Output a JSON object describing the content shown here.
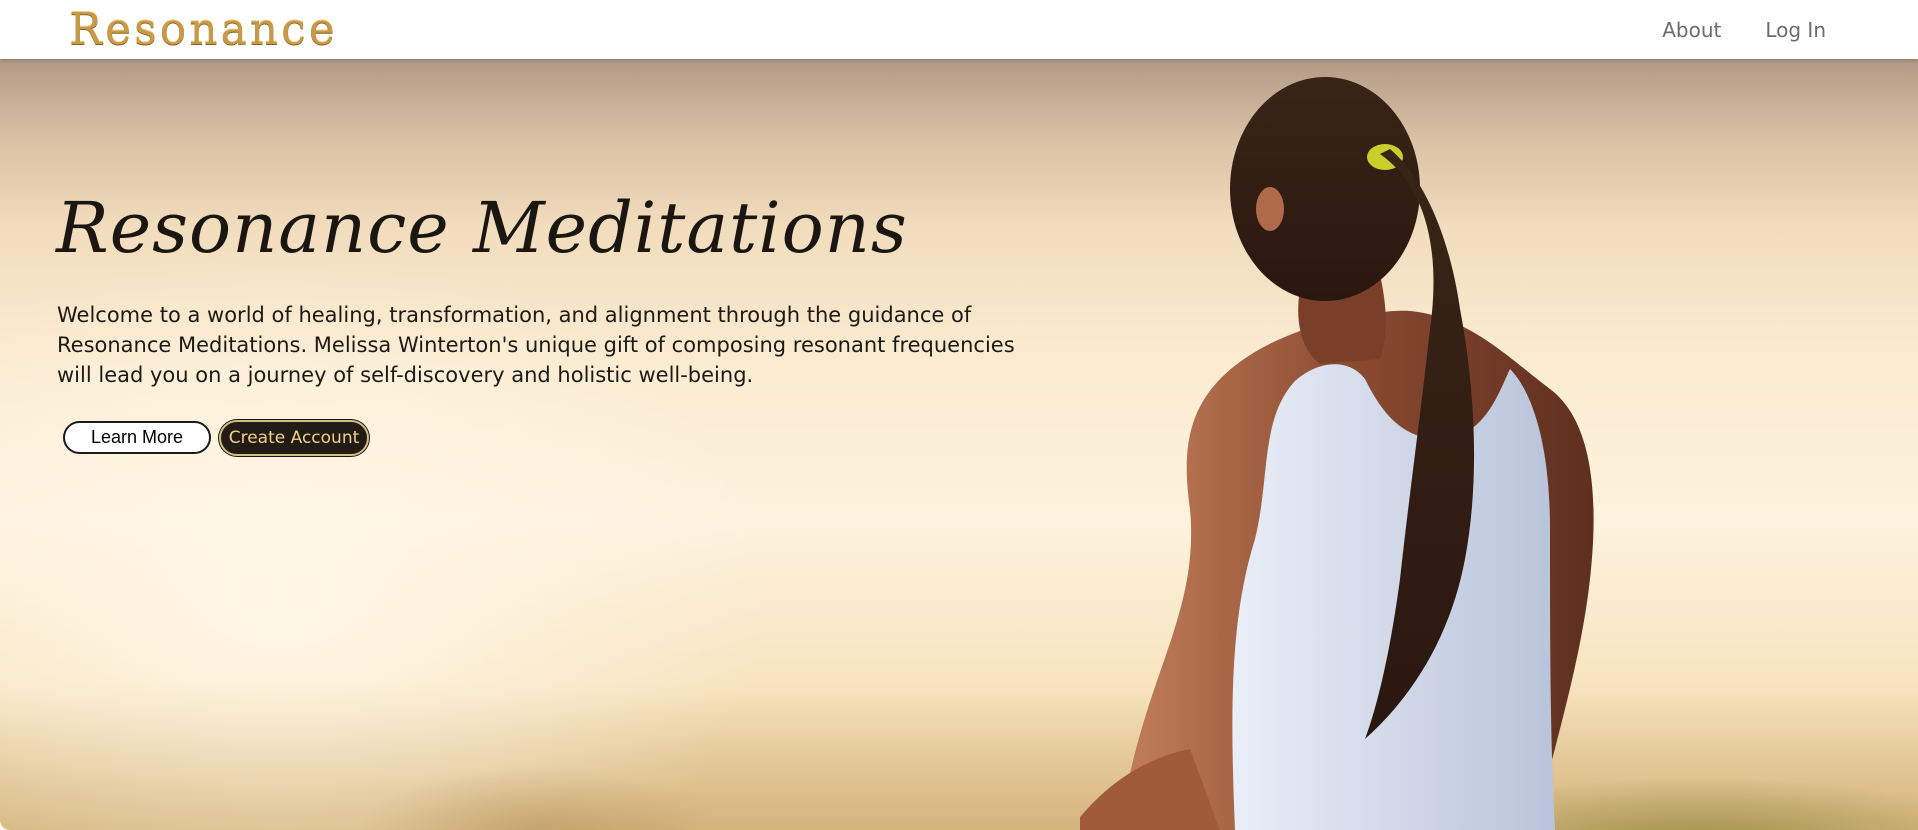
{
  "header": {
    "logo_text": "Resonance",
    "nav": [
      {
        "label": "About"
      },
      {
        "label": "Log In"
      }
    ]
  },
  "hero": {
    "title": "Resonance Meditations",
    "description": "Welcome to a world of healing, transformation, and alignment through the guidance of Resonance Meditations. Melissa Winterton's unique gift of composing resonant frequencies will lead you on a journey of self-discovery and holistic well-being.",
    "primary_button": "Learn More",
    "secondary_button": "Create Account",
    "background_image": "woman-meditating-at-sunset-photo"
  },
  "colors": {
    "logo_gold": "#c79a4a",
    "nav_text": "#6c6c6c",
    "create_button_bg": "#211c16",
    "create_button_text": "#f0d08a"
  }
}
